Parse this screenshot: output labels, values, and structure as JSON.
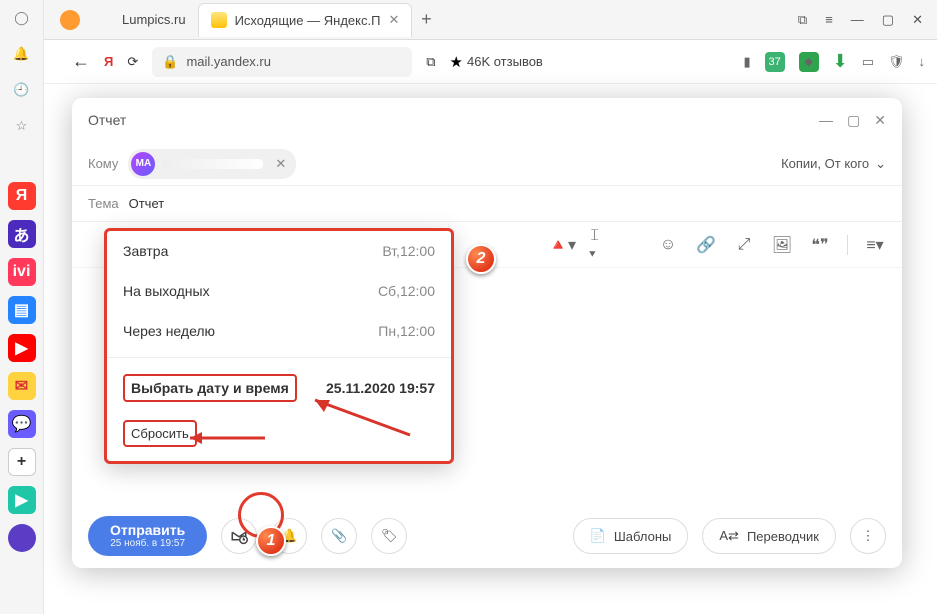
{
  "browser": {
    "tabs": [
      {
        "title": "Lumpics.ru",
        "favicon_color": "#ff8800"
      },
      {
        "title": "Исходящие — Яндекс.П",
        "favicon_color": "#ffcf3f"
      }
    ],
    "url_host": "mail.yandex.ru",
    "reviews": "46K отзывов"
  },
  "compose": {
    "title": "Отчет",
    "to_label": "Кому",
    "recipient_initials": "MA",
    "copies_label": "Копии, От кого",
    "subject_label": "Тема",
    "subject_value": "Отчет"
  },
  "popup": {
    "rows": [
      {
        "label": "Завтра",
        "time": "Вт,12:00"
      },
      {
        "label": "На выходных",
        "time": "Сб,12:00"
      },
      {
        "label": "Через неделю",
        "time": "Пн,12:00"
      }
    ],
    "pick_label": "Выбрать дату и время",
    "pick_value": "25.11.2020 19:57",
    "reset": "Сбросить"
  },
  "bottom": {
    "send": "Отправить",
    "send_sub": "25 нояб. в 19:57",
    "templates": "Шаблоны",
    "translator": "Переводчик"
  },
  "badges": {
    "one": "1",
    "two": "2"
  }
}
